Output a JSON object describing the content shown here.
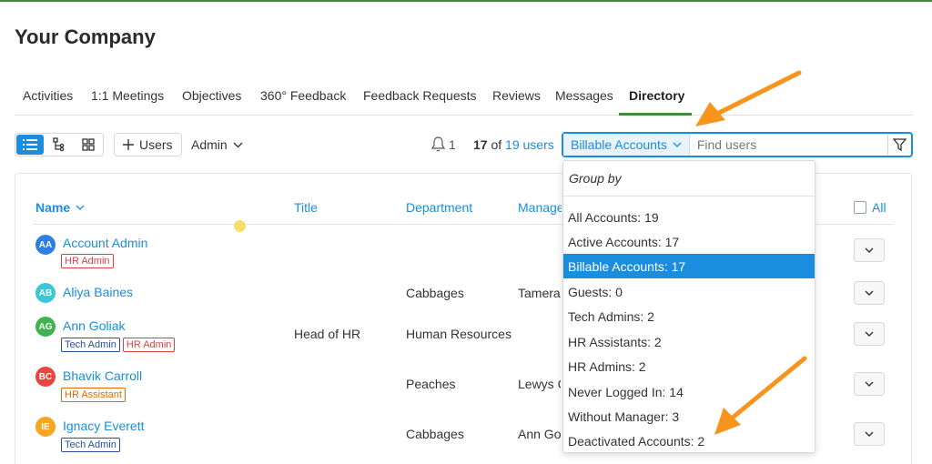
{
  "company": "Your Company",
  "tabs": [
    "Activities",
    "1:1 Meetings",
    "Objectives",
    "360° Feedback",
    "Feedback Requests",
    "Reviews",
    "Messages",
    "Directory"
  ],
  "active_tab": "Directory",
  "toolbar": {
    "add_users_label": "Users",
    "admin_label": "Admin",
    "notification_count": "1",
    "shown_count": "17",
    "of_label": "of",
    "total_link": "19 users",
    "filter_selected": "Billable Accounts",
    "search_placeholder": "Find users"
  },
  "table": {
    "headers": {
      "name": "Name",
      "title": "Title",
      "department": "Department",
      "manager": "Manager",
      "all": "All"
    },
    "rows": [
      {
        "initials": "AA",
        "name": "Account Admin",
        "badges": [
          {
            "label": "HR Admin"
          }
        ],
        "title": "",
        "department": "",
        "manager": ""
      },
      {
        "initials": "AB",
        "name": "Aliya Baines",
        "badges": [],
        "title": "",
        "department": "Cabbages",
        "manager": "Tamera"
      },
      {
        "initials": "AG",
        "name": "Ann Goliak",
        "badges": [
          {
            "label": "Tech Admin"
          },
          {
            "label": "HR Admin"
          }
        ],
        "title": "Head of HR",
        "department": "Human Resources",
        "manager": ""
      },
      {
        "initials": "BC",
        "name": "Bhavik Carroll",
        "badges": [
          {
            "label": "HR Assistant"
          }
        ],
        "title": "",
        "department": "Peaches",
        "manager": "Lewys C"
      },
      {
        "initials": "IE",
        "name": "Ignacy Everett",
        "badges": [
          {
            "label": "Tech Admin"
          }
        ],
        "title": "",
        "department": "Cabbages",
        "manager": "Ann Go"
      }
    ]
  },
  "dropdown": {
    "group_by_label": "Group by",
    "items": [
      "All Accounts: 19",
      "Active Accounts: 17",
      "Billable Accounts: 17",
      "Guests: 0",
      "Tech Admins: 2",
      "HR Assistants: 2",
      "HR Admins: 2",
      "Never Logged In: 14",
      "Without Manager: 3",
      "Deactivated Accounts: 2"
    ],
    "selected_index": 2
  },
  "colors": {
    "accent": "#1a8ddf",
    "green": "#3d8d3d",
    "arrow": "#f7941d",
    "avatar_colors": [
      "#2f7fe0",
      "#3cc7d6",
      "#3fb34f",
      "#e8453c",
      "#f5a623"
    ]
  }
}
